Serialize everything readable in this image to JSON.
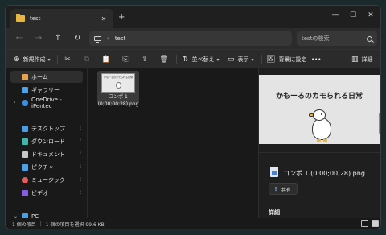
{
  "tab": {
    "title": "test",
    "close": "✕",
    "new_tab": "+"
  },
  "window_controls": {
    "minimize": "—",
    "maximize": "☐",
    "close": "✕"
  },
  "nav": {
    "back": "←",
    "forward": "→",
    "up": "↑",
    "refresh": "↻"
  },
  "address": {
    "separator": "›",
    "path": "test"
  },
  "search": {
    "placeholder": "testの検索"
  },
  "toolbar": {
    "new_label": "新規作成",
    "sort_label": "並べ替え",
    "view_label": "表示",
    "background_label": "背景に設定",
    "more_label": "•••",
    "details_label": "詳細"
  },
  "sidebar": {
    "items": [
      {
        "label": "ホーム",
        "icon": "home-icon",
        "color": "#e8a04a"
      },
      {
        "label": "ギャラリー",
        "icon": "gallery-icon",
        "color": "#4aa3e8"
      },
      {
        "label": "OneDrive - iPentec",
        "icon": "cloud-icon",
        "color": "#3a8ee6"
      },
      {
        "label": "デスクトップ",
        "icon": "desktop-icon",
        "color": "#4a9ee8"
      },
      {
        "label": "ダウンロード",
        "icon": "download-icon",
        "color": "#3fb6a8"
      },
      {
        "label": "ドキュメント",
        "icon": "document-icon",
        "color": "#c8c8c8"
      },
      {
        "label": "ピクチャ",
        "icon": "pictures-icon",
        "color": "#4aa3e8"
      },
      {
        "label": "ミュージック",
        "icon": "music-icon",
        "color": "#e85a5a"
      },
      {
        "label": "ビデオ",
        "icon": "video-icon",
        "color": "#8a5ae8"
      },
      {
        "label": "PC",
        "icon": "pc-icon",
        "color": "#4a9ee8"
      }
    ],
    "pin": "📌"
  },
  "file": {
    "name_line1": "コンポ 1",
    "name_line2": "(0;00;00;28).png",
    "thumb_title": "かも一るのカモられる日常"
  },
  "preview": {
    "image_title": "かもーるのカモられる日常",
    "filename": "コンポ 1 (0;00;00;28).png",
    "share_label": "共有",
    "details_heading": "詳細"
  },
  "status": {
    "count": "1 個の項目",
    "selection": "1 個の項目を選択  99.6 KB",
    "sep": "|"
  }
}
